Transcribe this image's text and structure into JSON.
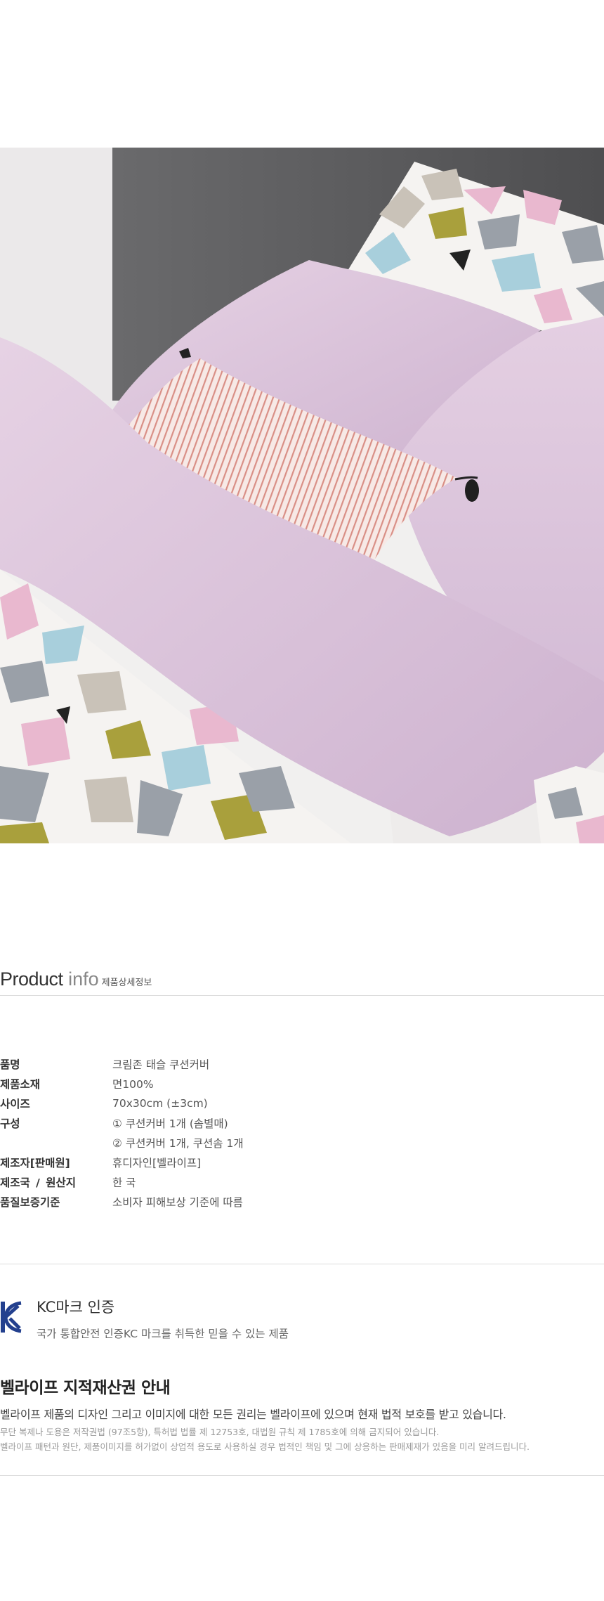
{
  "product_info": {
    "title_bold": "Product",
    "title_light": " info",
    "title_kr": "제품상세정보"
  },
  "specs": [
    {
      "label": "품명",
      "value": "크림존 태슬 쿠션커버"
    },
    {
      "label": "제품소재",
      "value": "면100%"
    },
    {
      "label": "사이즈",
      "value": "70x30cm (±3cm)"
    },
    {
      "label": "구성",
      "value": "① 쿠션커버 1개 (솜별매)"
    },
    {
      "label": "",
      "value": "② 쿠션커버 1개, 쿠션솜 1개"
    },
    {
      "label": "제조자[판매원]",
      "value": "휴디자인[벨라이프]"
    },
    {
      "label": "제조국 / 원산지",
      "value": "한 국"
    },
    {
      "label": "품질보증기준",
      "value": "소비자 피해보상 기준에 따름"
    }
  ],
  "kc": {
    "logo_text": "KC",
    "title": "KC마크 인증",
    "desc": "국가 통합안전 인증KC 마크를 취득한 믿을 수 있는 제품"
  },
  "ip_notice": {
    "title": "벨라이프 지적재산권 안내",
    "main": "벨라이프 제품의 디자인 그리고 이미지에 대한 모든 권리는 벨라이프에 있으며 현재 법적 보호를 받고 있습니다.",
    "small1": "무단 복제나 도용은 저작권법 (97조5항), 특허법 법률 제 12753호, 대법원 규칙 제 1785호에 의해 금지되어 있습니다.",
    "small2": "벨라이프 패턴과 원단, 제품이미지를 허가없이 상업적 용도로 사용하실 경우 법적인 책임 및 그에 상응하는 판매제재가 있음을 미리 알려드립니다."
  },
  "colors": {
    "lilac": "#dcc6dc",
    "wall": "#5a5a5c",
    "pattern_olive": "#a9a03c",
    "pattern_grey": "#9aa0a8",
    "pattern_blue": "#a8cfdc"
  }
}
